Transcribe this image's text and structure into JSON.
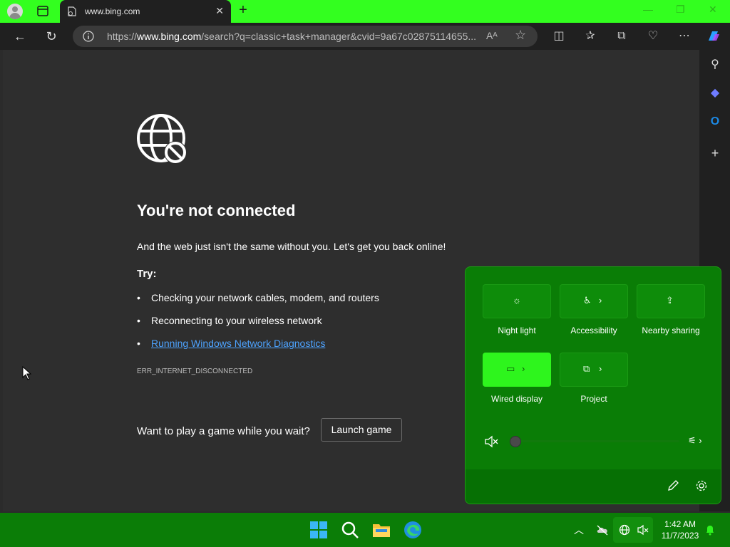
{
  "browser": {
    "tab_title": "www.bing.com",
    "url_prefix": "https://",
    "url_host": "www.bing.com",
    "url_rest": "/search?q=classic+task+manager&cvid=9a67c02875114655...",
    "read_aloud_label": "Aᴬ"
  },
  "page": {
    "heading": "You're not connected",
    "subtext": "And the web just isn't the same without you. Let's get you back online!",
    "try_label": "Try:",
    "bullets": [
      "Checking your network cables, modem, and routers",
      "Reconnecting to your wireless network",
      "Running Windows Network Diagnostics"
    ],
    "error_code": "ERR_INTERNET_DISCONNECTED",
    "game_prompt": "Want to play a game while you wait?",
    "launch_button": "Launch game"
  },
  "quick_settings": {
    "tiles": [
      {
        "label": "Night light",
        "icon": "brightness-icon",
        "active": false
      },
      {
        "label": "Accessibility",
        "icon": "accessibility-icon",
        "active": false
      },
      {
        "label": "Nearby sharing",
        "icon": "share-icon",
        "active": false
      },
      {
        "label": "Wired display",
        "icon": "cast-icon",
        "active": true
      },
      {
        "label": "Project",
        "icon": "project-icon",
        "active": false
      }
    ],
    "volume_level": 0
  },
  "taskbar": {
    "time": "1:42 AM",
    "date": "11/7/2023"
  },
  "colors": {
    "accent_green": "#33ff1f",
    "taskbar_green": "#0b7d07",
    "link_blue": "#4da3ff"
  }
}
